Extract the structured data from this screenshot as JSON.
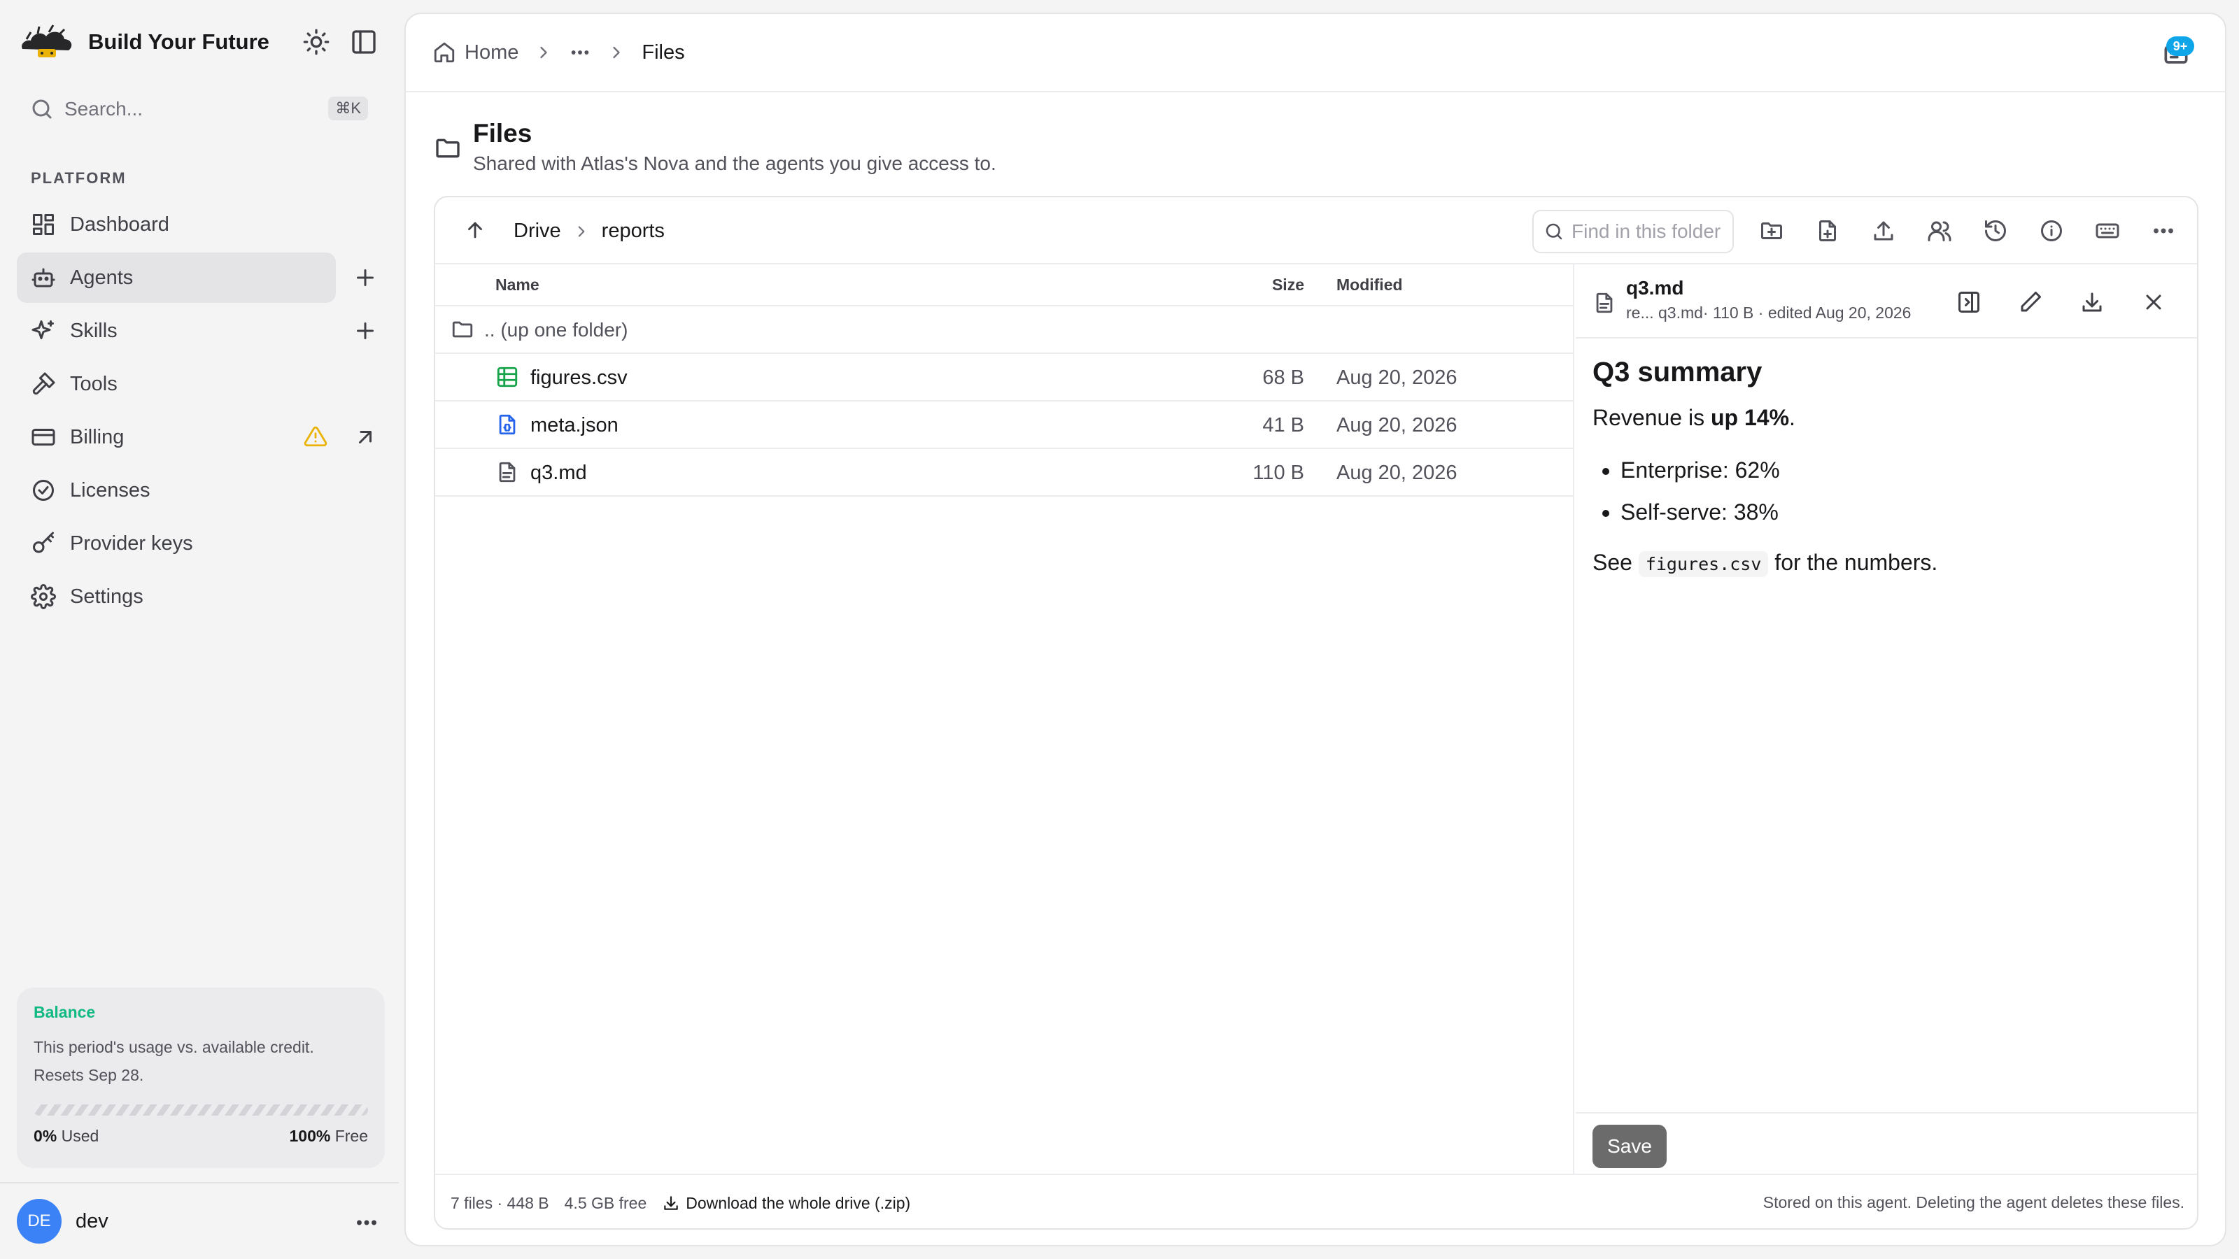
{
  "app": {
    "brand_name": "Build Your Future",
    "search_placeholder": "Search...",
    "search_shortcut": "⌘K"
  },
  "sidebar": {
    "section_label": "PLATFORM",
    "items": [
      {
        "label": "Dashboard",
        "icon": "dashboard-icon"
      },
      {
        "label": "Agents",
        "icon": "bot-icon",
        "active": true,
        "action": "plus-icon"
      },
      {
        "label": "Skills",
        "icon": "sparkles-icon",
        "action": "plus-icon"
      },
      {
        "label": "Tools",
        "icon": "hammer-icon"
      },
      {
        "label": "Billing",
        "icon": "credit-card-icon",
        "warning": true,
        "action": "external-link-icon"
      },
      {
        "label": "Licenses",
        "icon": "badge-check-icon"
      },
      {
        "label": "Provider keys",
        "icon": "key-icon"
      },
      {
        "label": "Settings",
        "icon": "gear-icon"
      }
    ],
    "balance": {
      "title": "Balance",
      "description": "This period's usage vs. available credit. Resets Sep 28.",
      "used_pct": 0,
      "used_value": "0%",
      "used_label": "Used",
      "free_value": "100%",
      "free_label": "Free"
    },
    "user": {
      "initials": "DE",
      "name": "dev"
    }
  },
  "header": {
    "breadcrumb": {
      "home": "Home",
      "current": "Files"
    },
    "notifications_badge": "9+"
  },
  "page": {
    "title": "Files",
    "subtitle": "Shared with Atlas's Nova and the agents you give access to."
  },
  "browser": {
    "path": [
      "Drive",
      "reports"
    ],
    "find_placeholder": "Find in this folder",
    "columns": {
      "name": "Name",
      "size": "Size",
      "modified": "Modified"
    },
    "up_row": ".. (up one folder)",
    "files": [
      {
        "name": "figures.csv",
        "size": "68 B",
        "modified": "Aug 20, 2026",
        "icon": "spreadsheet-icon",
        "color": "#16a34a"
      },
      {
        "name": "meta.json",
        "size": "41 B",
        "modified": "Aug 20, 2026",
        "icon": "json-file-icon",
        "color": "#2563eb"
      },
      {
        "name": "q3.md",
        "size": "110 B",
        "modified": "Aug 20, 2026",
        "icon": "text-file-icon",
        "color": "#52525b"
      }
    ],
    "footer": {
      "stats": "7 files · 448 B",
      "free": "4.5 GB free",
      "download": "Download the whole drive (.zip)",
      "note": "Stored on this agent. Deleting the agent deletes these files."
    }
  },
  "preview": {
    "file_name": "q3.md",
    "meta": "re... q3.md· 110 B · edited Aug 20, 2026",
    "heading": "Q3 summary",
    "para1_prefix": "Revenue is ",
    "para1_bold": "up 14%",
    "para1_suffix": ".",
    "bullets": [
      "Enterprise: 62%",
      "Self-serve: 38%"
    ],
    "para2_prefix": "See ",
    "para2_code": "figures.csv",
    "para2_suffix": " for the numbers.",
    "save_label": "Save"
  },
  "colors": {
    "accent_green": "#10b981",
    "notification_blue": "#0ea5e9",
    "warning_yellow": "#eab308",
    "avatar_blue": "#3b82f6"
  }
}
